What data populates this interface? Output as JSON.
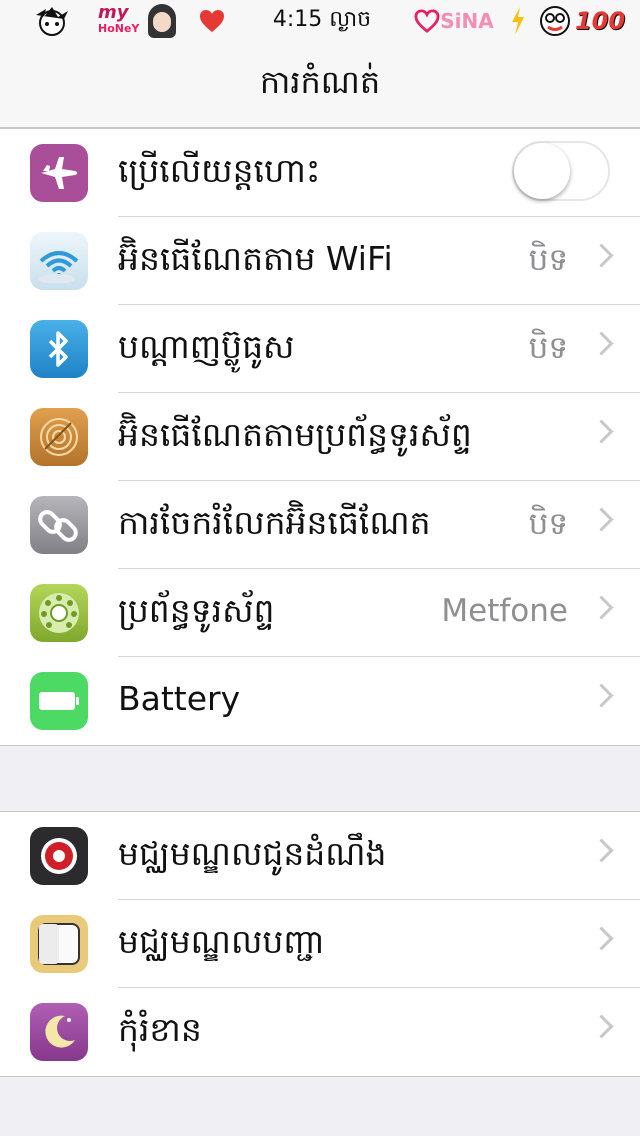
{
  "status_bar": {
    "time": "4:15 ល្ងាច",
    "sticker_my": "my",
    "sticker_honey": "HoNeY",
    "sticker_sina": "SiNA",
    "battery_level": "100"
  },
  "nav": {
    "title": "ការកំណត់"
  },
  "group1": [
    {
      "label": "ប្រើលើយន្តហោះ",
      "value": "",
      "icon": "airplane-icon",
      "color": "#a94f9a",
      "toggle": "off"
    },
    {
      "label": "អ៊ិនធើណែតតាម WiFi",
      "value": "បិទ",
      "icon": "wifi-icon",
      "color": "#d6e9f4"
    },
    {
      "label": "បណ្តាញប៊្លូធូស",
      "value": "បិទ",
      "icon": "bluetooth-icon",
      "color": "#2e9bd8"
    },
    {
      "label": "អ៊ិនធើណែតតាមប្រព័ន្ធទូរស័ព្ទ",
      "value": "",
      "icon": "cellular-icon",
      "color": "#c9873a"
    },
    {
      "label": "ការចែករំលែកអ៊ិនធើណែត",
      "value": "បិទ",
      "icon": "link-icon",
      "color": "#8e8e93"
    },
    {
      "label": "ប្រព័ន្ធទូរស័ព្ទ",
      "value": "Metfone",
      "icon": "rotary-phone-icon",
      "color": "#9bc43d"
    },
    {
      "label": "Battery",
      "value": "",
      "icon": "battery-icon",
      "color": "#4cd964"
    }
  ],
  "group2": [
    {
      "label": "មជ្ឈមណ្ឌលជូនដំណឹង",
      "value": "",
      "icon": "notification-icon",
      "color": "#1c1c1e"
    },
    {
      "label": "មជ្ឈមណ្ឌលបញ្ជា",
      "value": "",
      "icon": "control-center-icon",
      "color": "#e9c97a"
    },
    {
      "label": "កុំរំខាន",
      "value": "",
      "icon": "moon-icon",
      "color": "#9b4ea0"
    }
  ]
}
